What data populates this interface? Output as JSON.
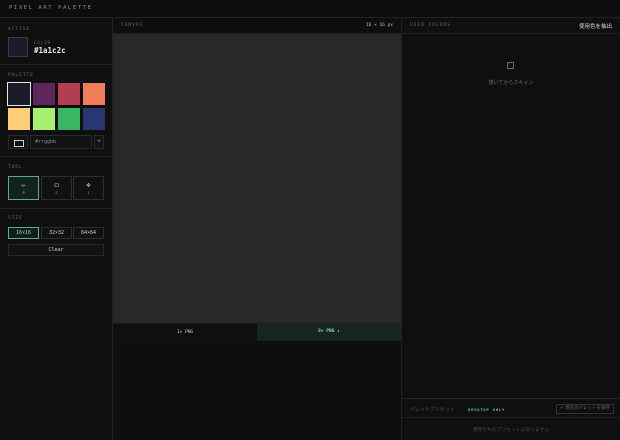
{
  "app": {
    "title": "PIXEL ART PALETTE"
  },
  "active": {
    "section_label": "ACTIVE",
    "sub_label": "COLOR",
    "hex": "#1a1c2c",
    "color": "#1a1c2c"
  },
  "palette": {
    "section_label": "PALETTE",
    "swatches": [
      "#1a1c2c",
      "#5d275d",
      "#b13e53",
      "#ef7d57",
      "#ffcd75",
      "#a7f070",
      "#38b764",
      "#29366f"
    ],
    "selected_index": 0,
    "hex_input_placeholder": "#rrggbb",
    "add_label": "+"
  },
  "tool": {
    "section_label": "TOOL",
    "items": [
      {
        "glyph": "✏",
        "key": "P",
        "icon": "pencil-icon"
      },
      {
        "glyph": "◻",
        "key": "E",
        "icon": "eraser-icon"
      },
      {
        "glyph": "✜",
        "key": "I",
        "icon": "eyedropper-icon"
      }
    ],
    "active_index": 0
  },
  "size": {
    "section_label": "SIZE",
    "options": [
      "16×16",
      "32×32",
      "64×64"
    ],
    "active_index": 0,
    "clear_label": "Clear"
  },
  "canvas": {
    "title": "CANVAS",
    "dims": "16 × 16 px",
    "export_1x": "1× PNG",
    "export_8x": "8× PNG ↓"
  },
  "used_colors": {
    "title": "USED COLORS",
    "extract_label": "使用色を抽出",
    "empty_text": "描いてからスキャン"
  },
  "presets": {
    "label": "パレットプリセット",
    "badge": "DESKTOP ONLY",
    "save_label": "+ 現在のパレットを保存",
    "empty_text": "保存されたプリセットはありません"
  },
  "colors": {
    "accent": "#4fb38f",
    "accent_text": "#7fe0b8",
    "background": "#0e0e0e"
  }
}
